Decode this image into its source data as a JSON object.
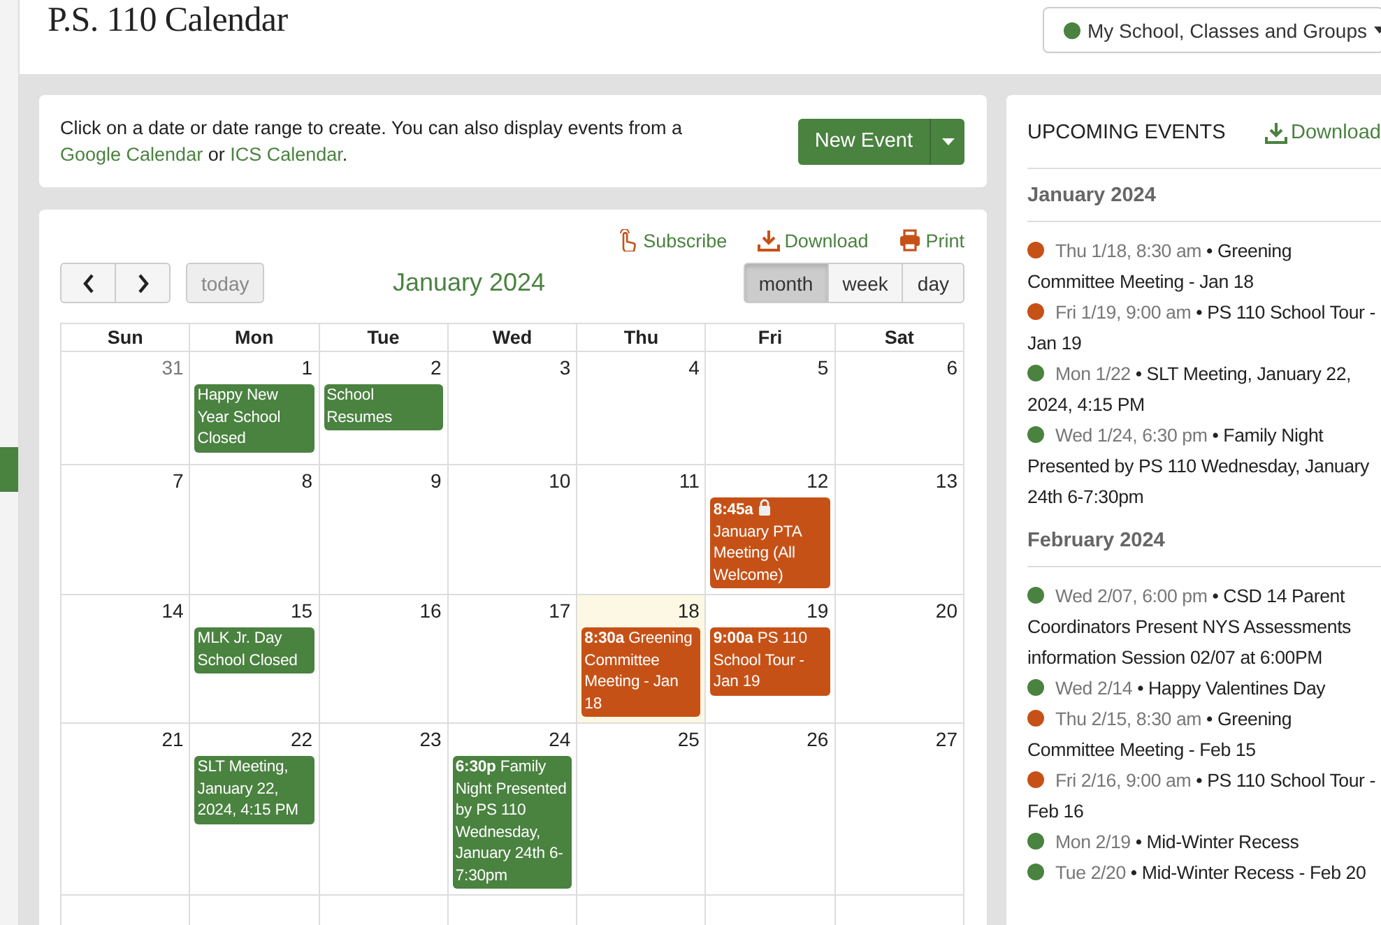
{
  "page_title": "P.S. 110 Calendar",
  "calendar_filter": {
    "label": "My School, Classes and Groups",
    "color": "#4a8240"
  },
  "info": {
    "text": "Click on a date or date range to create. You can also display events from a",
    "links": [
      "Google Calendar",
      "ICS Calendar"
    ],
    "joiner": "or",
    "end": "."
  },
  "new_event_button": "New Event",
  "calendar_links": [
    "Subscribe",
    "Download",
    "Print"
  ],
  "toolbar": {
    "today": "today",
    "title": "January 2024",
    "views": [
      {
        "label": "month",
        "selected": true
      },
      {
        "label": "week",
        "selected": false
      },
      {
        "label": "day",
        "selected": false
      }
    ]
  },
  "weekdays": [
    "Sun",
    "Mon",
    "Tue",
    "Wed",
    "Thu",
    "Fri",
    "Sat"
  ],
  "weeks": [
    [
      {
        "day": "31",
        "other_month": true,
        "today": false
      },
      {
        "day": "1",
        "other_month": false,
        "today": false,
        "events": [
          {
            "title": "Happy New Year School Closed",
            "color": "#4a8240"
          }
        ]
      },
      {
        "day": "2",
        "other_month": false,
        "today": false,
        "events": [
          {
            "title": "School Resumes",
            "color": "#4a8240"
          }
        ]
      },
      {
        "day": "3",
        "other_month": false,
        "today": false
      },
      {
        "day": "4",
        "other_month": false,
        "today": false
      },
      {
        "day": "5",
        "other_month": false,
        "today": false
      },
      {
        "day": "6",
        "other_month": false,
        "today": false
      }
    ],
    [
      {
        "day": "7",
        "other_month": false,
        "today": false
      },
      {
        "day": "8",
        "other_month": false,
        "today": false
      },
      {
        "day": "9",
        "other_month": false,
        "today": false
      },
      {
        "day": "10",
        "other_month": false,
        "today": false
      },
      {
        "day": "11",
        "other_month": false,
        "today": false
      },
      {
        "day": "12",
        "other_month": false,
        "today": false,
        "events": [
          {
            "time": "8:45a",
            "locked": true,
            "title": "January PTA Meeting (All Welcome)",
            "color": "#c65117"
          }
        ]
      },
      {
        "day": "13",
        "other_month": false,
        "today": false
      }
    ],
    [
      {
        "day": "14",
        "other_month": false,
        "today": false
      },
      {
        "day": "15",
        "other_month": false,
        "today": false,
        "events": [
          {
            "title": "MLK Jr. Day School Closed",
            "color": "#4a8240"
          }
        ]
      },
      {
        "day": "16",
        "other_month": false,
        "today": false
      },
      {
        "day": "17",
        "other_month": false,
        "today": false
      },
      {
        "day": "18",
        "other_month": false,
        "today": true,
        "events": [
          {
            "time": "8:30a",
            "title": "Greening Committee Meeting - Jan 18",
            "color": "#c65117"
          }
        ]
      },
      {
        "day": "19",
        "other_month": false,
        "today": false,
        "events": [
          {
            "time": "9:00a",
            "title": "PS 110 School Tour - Jan 19",
            "color": "#c65117"
          }
        ]
      },
      {
        "day": "20",
        "other_month": false,
        "today": false
      }
    ],
    [
      {
        "day": "21",
        "other_month": false,
        "today": false
      },
      {
        "day": "22",
        "other_month": false,
        "today": false,
        "events": [
          {
            "title": "SLT Meeting, January 22, 2024, 4:15 PM",
            "color": "#4a8240"
          }
        ]
      },
      {
        "day": "23",
        "other_month": false,
        "today": false
      },
      {
        "day": "24",
        "other_month": false,
        "today": false,
        "events": [
          {
            "time": "6:30p",
            "title": "Family Night Presented by PS 110 Wednesday, January 24th 6-7:30pm",
            "color": "#4a8240"
          }
        ]
      },
      {
        "day": "25",
        "other_month": false,
        "today": false
      },
      {
        "day": "26",
        "other_month": false,
        "today": false
      },
      {
        "day": "27",
        "other_month": false,
        "today": false
      }
    ]
  ],
  "upcoming": {
    "title": "UPCOMING EVENTS",
    "download": "Download",
    "months": [
      {
        "month": "January 2024",
        "events": [
          {
            "when": "Thu 1/18, 8:30 am",
            "title": "• Greening Committee Meeting - Jan 18",
            "color": "#c65117"
          },
          {
            "when": "Fri 1/19, 9:00 am",
            "title": "• PS 110 School Tour - Jan 19",
            "color": "#c65117"
          },
          {
            "when": "Mon 1/22",
            "title": "• SLT Meeting, January 22, 2024, 4:15 PM",
            "color": "#4a8240"
          },
          {
            "when": "Wed 1/24, 6:30 pm",
            "title": "• Family Night Presented by PS 110 Wednesday, January 24th 6-7:30pm",
            "color": "#4a8240"
          }
        ]
      },
      {
        "month": "February 2024",
        "events": [
          {
            "when": "Wed 2/07, 6:00 pm",
            "title": "• CSD 14 Parent Coordinators Present NYS Assessments information Session 02/07 at 6:00PM",
            "color": "#4a8240"
          },
          {
            "when": "Wed 2/14",
            "title": "• Happy Valentines Day",
            "color": "#4a8240"
          },
          {
            "when": "Thu 2/15, 8:30 am",
            "title": "• Greening Committee Meeting - Feb 15",
            "color": "#c65117"
          },
          {
            "when": "Fri 2/16, 9:00 am",
            "title": "• PS 110 School Tour - Feb 16",
            "color": "#c65117"
          },
          {
            "when": "Mon 2/19",
            "title": "• Mid-Winter Recess",
            "color": "#4a8240"
          },
          {
            "when": "Tue 2/20",
            "title": "• Mid-Winter Recess - Feb 20",
            "color": "#4a8240"
          }
        ]
      }
    ]
  }
}
